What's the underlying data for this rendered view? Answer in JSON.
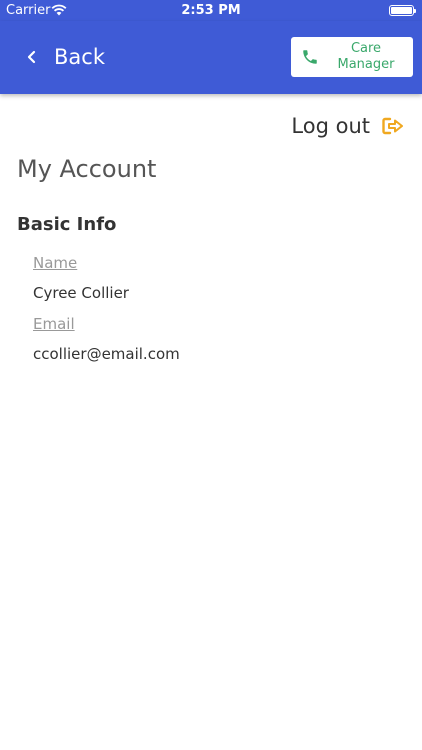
{
  "status_bar": {
    "carrier": "Carrier",
    "time": "2:53 PM"
  },
  "header": {
    "back_label": "Back",
    "care_manager_label": "Care Manager",
    "brand_color": "#3f5bd6",
    "care_color": "#3aa86b"
  },
  "logout": {
    "label": "Log out",
    "icon_color": "#f0a820"
  },
  "page": {
    "title": "My Account",
    "section_title": "Basic Info",
    "fields": [
      {
        "label": "Name",
        "value": "Cyree Collier"
      },
      {
        "label": "Email",
        "value": "ccollier@email.com"
      }
    ]
  }
}
